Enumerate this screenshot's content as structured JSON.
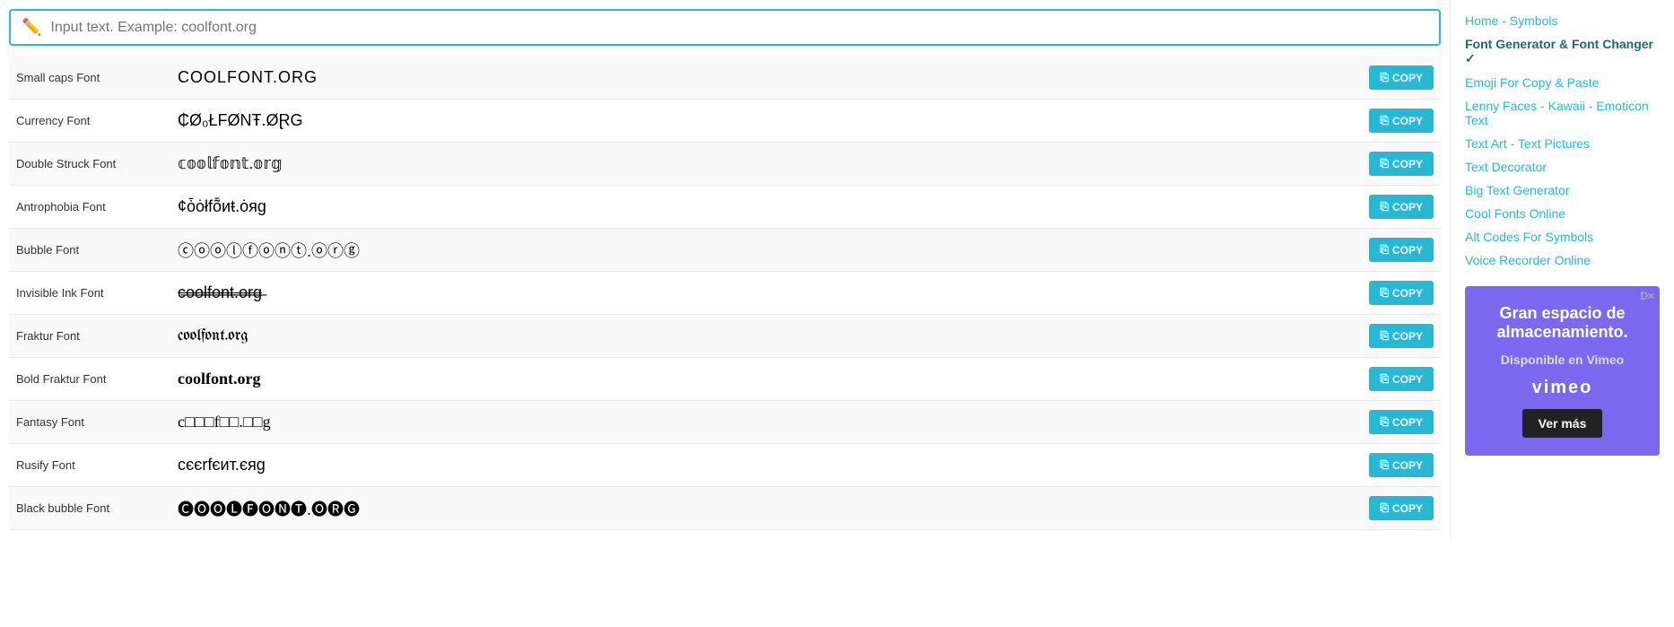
{
  "search": {
    "placeholder": "Input text. Example: coolfont.org",
    "value": ""
  },
  "sidebar": {
    "links": [
      {
        "label": "Home - Symbols",
        "active": false,
        "id": "home-symbols"
      },
      {
        "label": "Font Generator & Font Changer ✓",
        "active": true,
        "id": "font-generator"
      },
      {
        "label": "Emoji For Copy & Paste",
        "active": false,
        "id": "emoji-copy"
      },
      {
        "label": "Lenny Faces - Kawaii - Emoticon Text",
        "active": false,
        "id": "lenny-faces"
      },
      {
        "label": "Text Art - Text Pictures",
        "active": false,
        "id": "text-art"
      },
      {
        "label": "Text Decorator",
        "active": false,
        "id": "text-decorator"
      },
      {
        "label": "Big Text Generator",
        "active": false,
        "id": "big-text"
      },
      {
        "label": "Cool Fonts Online",
        "active": false,
        "id": "cool-fonts-online"
      },
      {
        "label": "Alt Codes For Symbols",
        "active": false,
        "id": "alt-codes"
      },
      {
        "label": "Voice Recorder Online",
        "active": false,
        "id": "voice-recorder"
      }
    ]
  },
  "ad": {
    "title": "Gran espacio de almacenamiento.",
    "subtitle": "Disponible en Vimeo",
    "logo": "vimeo",
    "button": "Ver más",
    "close": "D×"
  },
  "copy_label": "COPY",
  "fonts": [
    {
      "name": "Small caps Font",
      "text": "COOLFONT.ORG",
      "class": "small-caps"
    },
    {
      "name": "Currency Font",
      "text": "₵Ø₀ŁFØNŦ.ØⱤG",
      "class": "currency-font"
    },
    {
      "name": "Double Struck Font",
      "text": "𝕔𝕠𝕠𝕝𝕗𝕠𝕟𝕥.𝕠𝕣𝕘",
      "class": "double-struck"
    },
    {
      "name": "Antrophobia Font",
      "text": "¢ȱȯłfȭиŧ.ȯяg",
      "class": "antrophobia"
    },
    {
      "name": "Bubble Font",
      "text": "ⓒⓞⓞⓛⓕⓞⓝⓣ.ⓞⓡⓖ",
      "class": "bubble"
    },
    {
      "name": "Invisible Ink Font",
      "text": "c̶o̶o̶l̶f̶o̶n̶t̶.̶o̶r̶g̶",
      "class": "invisible-ink"
    },
    {
      "name": "Fraktur Font",
      "text": "coolfont.org",
      "class": "fraktur"
    },
    {
      "name": "Bold Fraktur Font",
      "text": "coolfont.org",
      "class": "bold-fraktur"
    },
    {
      "name": "Fantasy Font",
      "text": "c□□□f□□.□□g",
      "class": "fantasy"
    },
    {
      "name": "Rusify Font",
      "text": "cєєrfєит.єяg",
      "class": "rusify"
    },
    {
      "name": "Black bubble Font",
      "text": "🅒🅞🅞🅛🅕🅞🅝🅣.🅞🅡🅖",
      "class": "black-bubble"
    }
  ]
}
